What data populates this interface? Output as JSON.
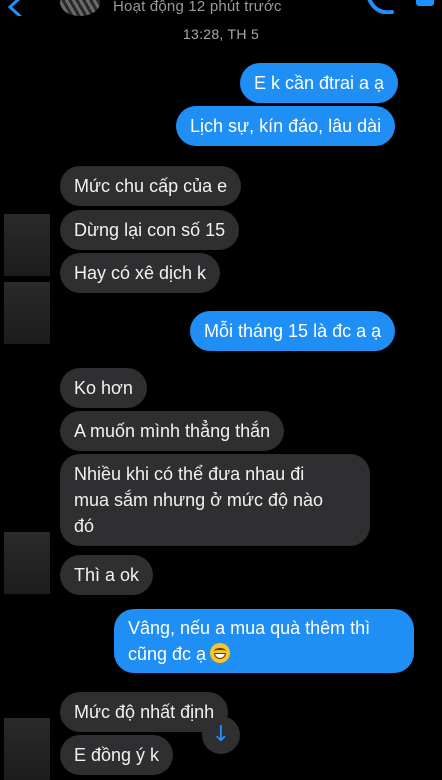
{
  "header": {
    "active_status": "Hoạt động 12 phút trước",
    "icons": [
      "back-icon",
      "avatar",
      "phone-icon",
      "video-icon"
    ]
  },
  "timestamp": "13:28, TH 5",
  "messages": [
    {
      "direction": "out",
      "text": "E k cần đtrai a ạ"
    },
    {
      "direction": "out",
      "text": "Lịch sự, kín đáo, lâu dài"
    },
    {
      "direction": "in",
      "text": "Mức chu cấp của e"
    },
    {
      "direction": "in",
      "text": "Dừng lại con số 15"
    },
    {
      "direction": "in",
      "text": "Hay có xê dịch k"
    },
    {
      "direction": "out",
      "text": "Mỗi tháng 15 là đc a ạ"
    },
    {
      "direction": "in",
      "text": "Ko hơn"
    },
    {
      "direction": "in",
      "text": "A muốn mình thẳng thắn"
    },
    {
      "direction": "in",
      "lines": [
        "Nhiều khi có thể đưa nhau đi",
        "mua sắm nhưng ở mức độ nào",
        "đó"
      ]
    },
    {
      "direction": "in",
      "text": "Thì a ok"
    },
    {
      "direction": "out",
      "lines": [
        "Vâng, nếu a mua quà thêm thì",
        "cũng đc ạ"
      ],
      "emoji": "grinning-face-emoji"
    },
    {
      "direction": "in",
      "text": "Mức độ nhất định"
    },
    {
      "direction": "in",
      "text": "E đồng ý k"
    }
  ],
  "scroll_button": {
    "icon": "arrow-down-icon",
    "glyph": "↓"
  },
  "colors": {
    "background": "#000000",
    "outgoing_bubble": "#1f8ff5",
    "incoming_bubble": "#2f2f31",
    "accent": "#1e90ff"
  }
}
